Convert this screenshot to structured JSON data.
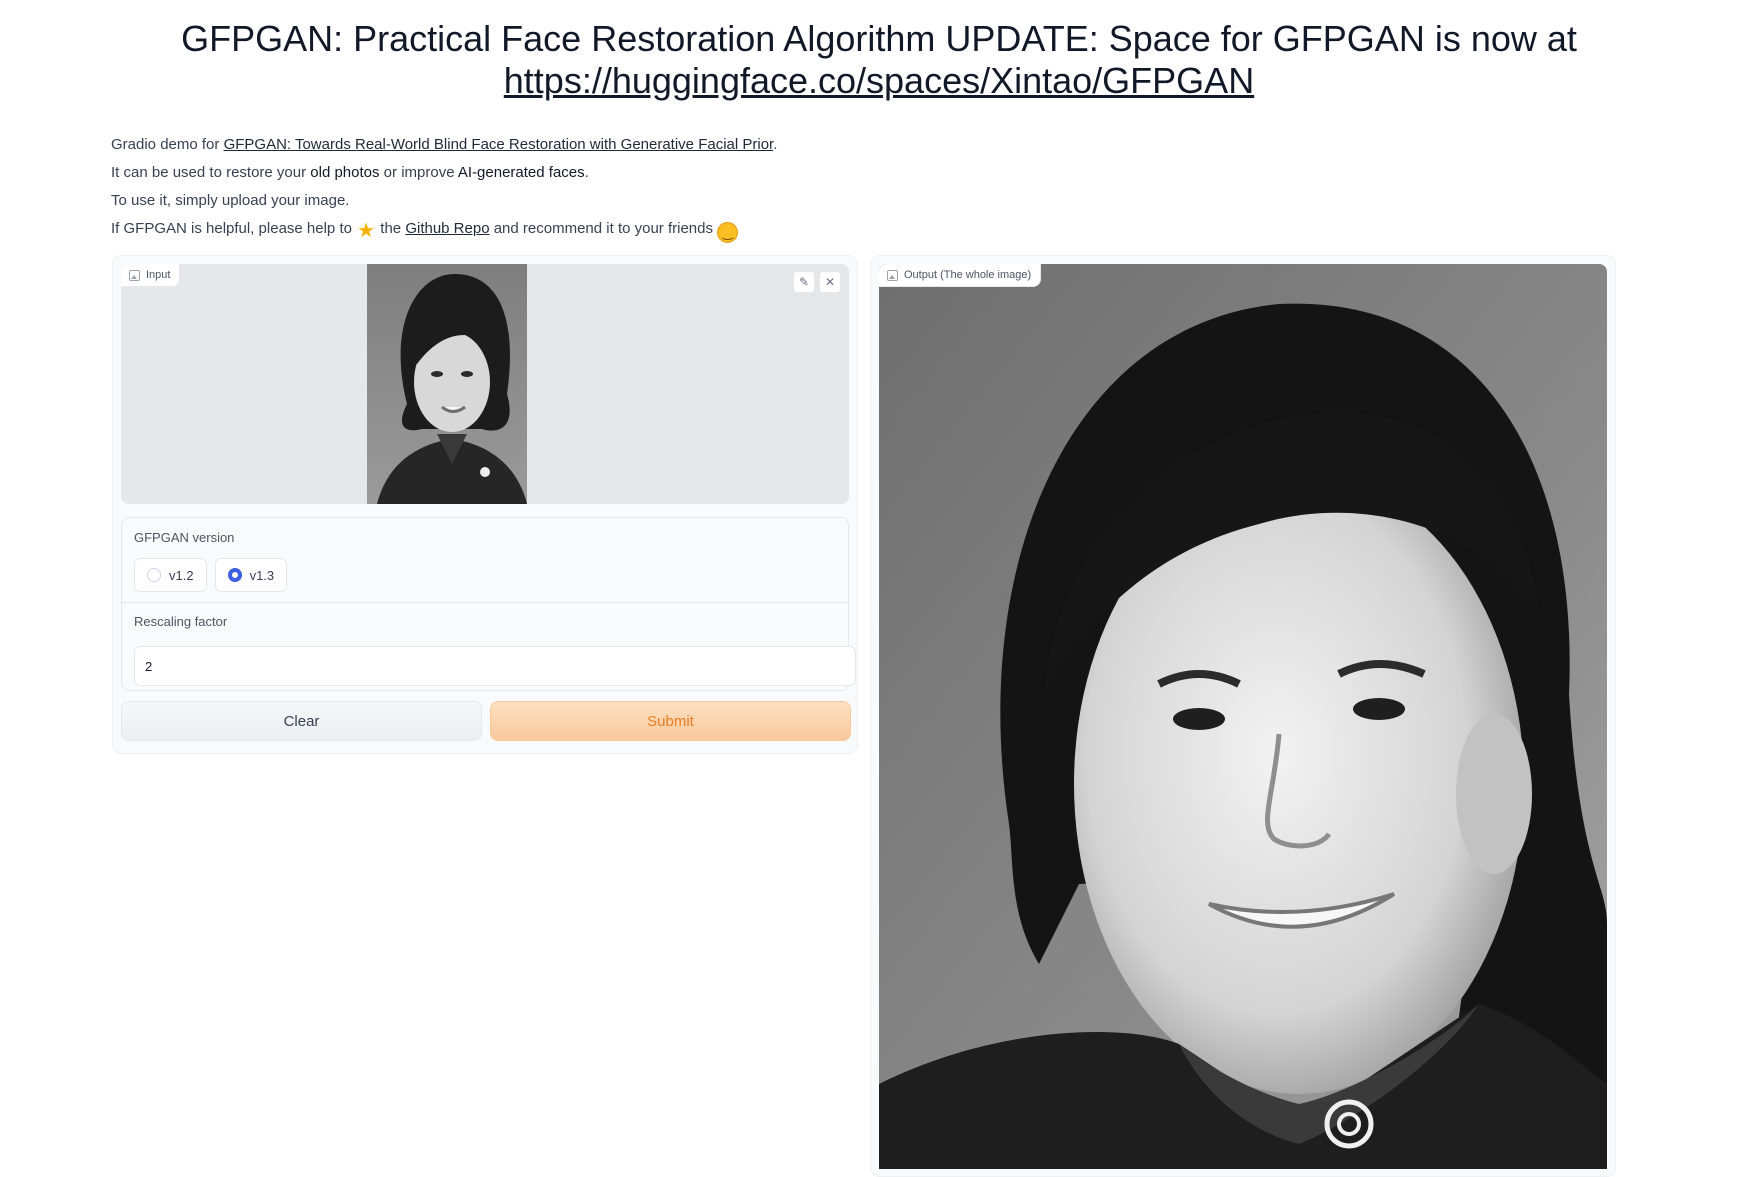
{
  "header": {
    "title_prefix": "GFPGAN: Practical Face Restoration Algorithm UPDATE: Space for GFPGAN is now at",
    "title_link": "https://huggingface.co/spaces/Xintao/GFPGAN"
  },
  "description": {
    "line1_pre": "Gradio demo for ",
    "line1_link": "GFPGAN: Towards Real-World Blind Face Restoration with Generative Facial Prior",
    "line1_post": ".",
    "line2_pre": "It can be used to restore your ",
    "line2_bold1": "old photos",
    "line2_mid": " or improve ",
    "line2_bold2": "AI-generated faces",
    "line2_post": ".",
    "line3": "To use it, simply upload your image.",
    "line4_pre": "If GFPGAN is helpful, please help to ",
    "line4_mid": " the ",
    "line4_link": "Github Repo",
    "line4_post": " and recommend it to your friends "
  },
  "input_panel": {
    "label": "Input",
    "edit_icon": "pencil-icon",
    "close_icon": "close-icon"
  },
  "settings": {
    "version_label": "GFPGAN version",
    "options": [
      "v1.2",
      "v1.3"
    ],
    "selected": "v1.3",
    "rescale_label": "Rescaling factor",
    "rescale_value": "2"
  },
  "buttons": {
    "clear": "Clear",
    "submit": "Submit"
  },
  "output_panel": {
    "label": "Output (The whole image)"
  },
  "colors": {
    "accent": "#3b5fe0",
    "submit_bg": "#f9c99b",
    "submit_text": "#e67e22"
  }
}
